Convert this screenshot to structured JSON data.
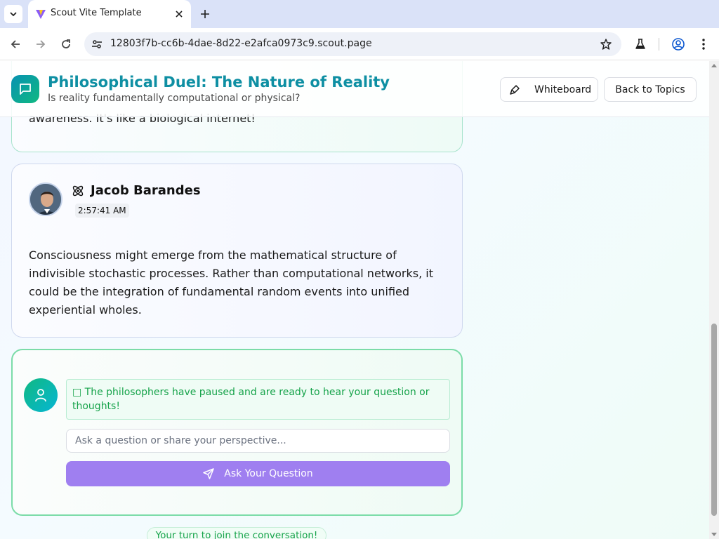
{
  "browser": {
    "tab_title": "Scout Vite Template",
    "url": "12803f7b-cc6b-4dae-8d22-e2afca0973c9.scout.page"
  },
  "header": {
    "title": "Philosophical Duel: The Nature of Reality",
    "subtitle": "Is reality fundamentally computational or physical?",
    "whiteboard_label": "Whiteboard",
    "back_label": "Back to Topics"
  },
  "previous_message": {
    "visible_text": "awareness. It's like a biological internet!"
  },
  "message": {
    "speaker": "Jacob Barandes",
    "time": "2:57:41 AM",
    "text": "Consciousness might emerge from the mathematical structure of indivisible stochastic processes. Rather than computational networks, it could be the integration of fundamental random events into unified experiential wholes."
  },
  "input_panel": {
    "notice": "□ The philosophers have paused and are ready to hear your question or thoughts!",
    "placeholder": "Ask a question or share your perspective...",
    "value": "",
    "ask_label": "Ask Your Question"
  },
  "turn_badge": "Your turn to join the conversation!",
  "colors": {
    "title": "#0e8fa3",
    "ask_button": "#9f7ff0",
    "notice_text": "#16a34a",
    "input_card_border": "#7bdca8"
  },
  "icons": [
    "chevron-down-icon",
    "favicon-icon",
    "close-icon",
    "plus-icon",
    "back-arrow-icon",
    "forward-arrow-icon",
    "reload-icon",
    "site-info-icon",
    "star-icon",
    "labs-flask-icon",
    "profile-icon",
    "more-vert-icon",
    "chat-bubble-icon",
    "pen-icon",
    "atom-icon",
    "user-icon",
    "send-icon"
  ]
}
